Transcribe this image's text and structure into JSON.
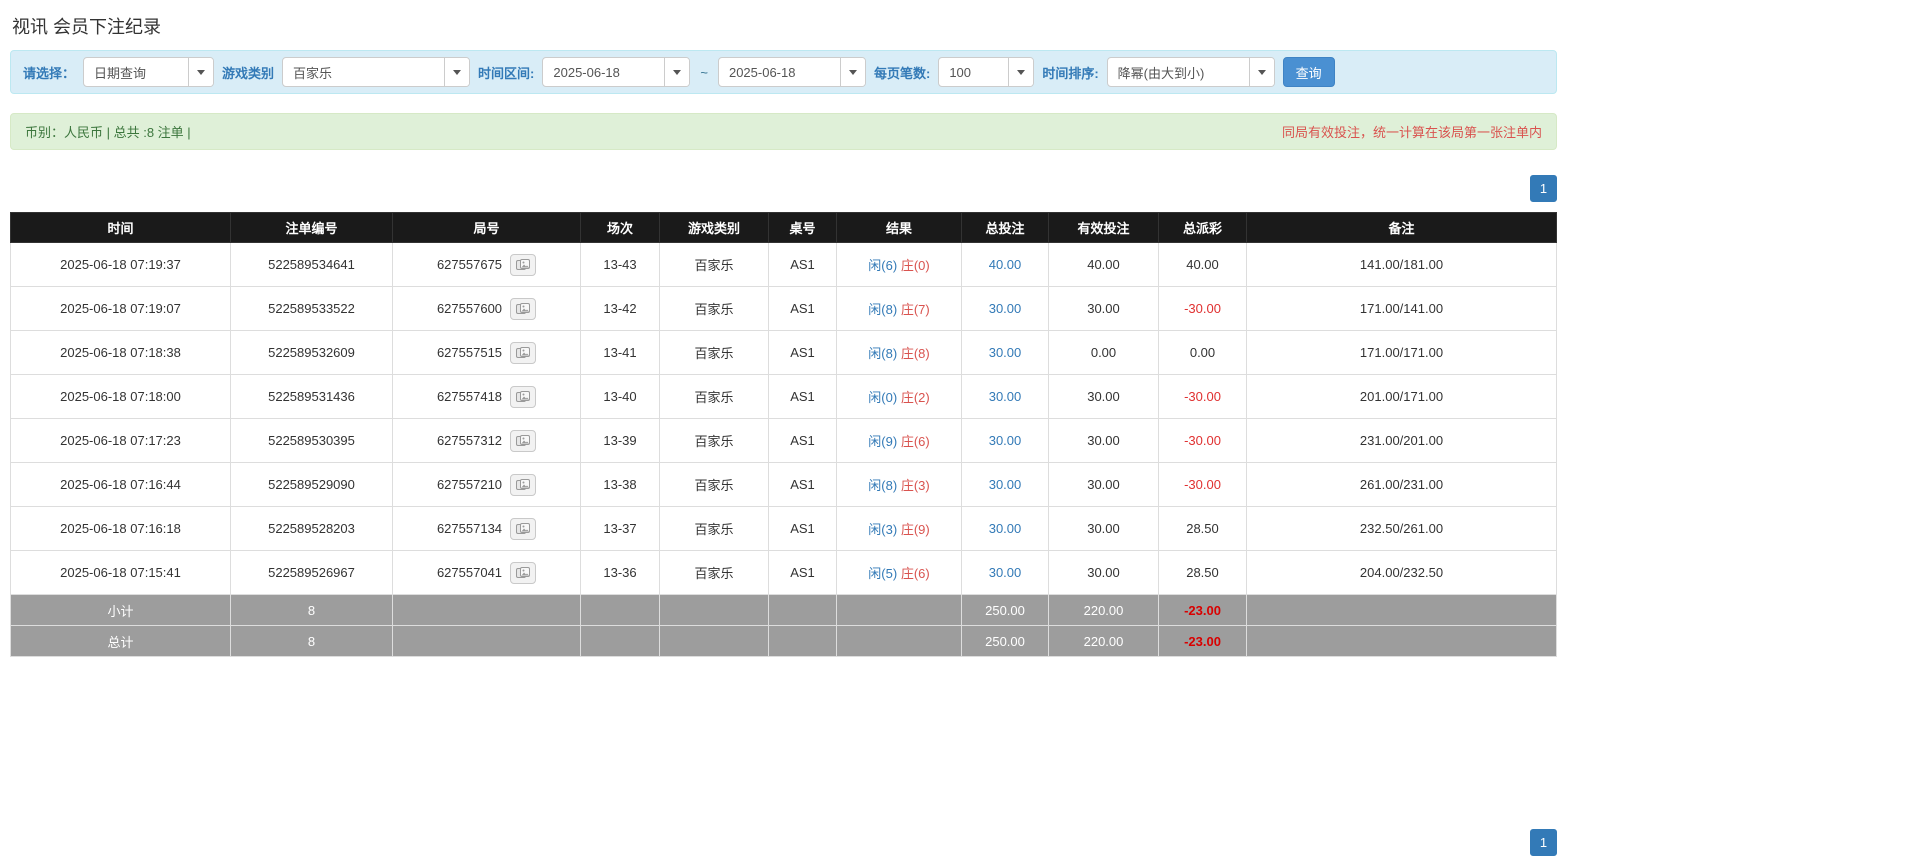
{
  "page": {
    "title": "视讯 会员下注纪录"
  },
  "filters": {
    "select_label": "请选择：",
    "select_value": "日期查询",
    "game_type_label": "游戏类别",
    "game_type_value": "百家乐",
    "time_range_label": "时间区间:",
    "date_from": "2025-06-18",
    "date_separator": "~",
    "date_to": "2025-06-18",
    "page_size_label": "每页笔数:",
    "page_size_value": "100",
    "sort_label": "时间排序:",
    "sort_value": "降幂(由大到小)",
    "search_button": "查询"
  },
  "info_bar": {
    "left": "币别：人民币 | 总共 :8 注单 |",
    "right": "同局有效投注，统一计算在该局第一张注单内"
  },
  "pagination": {
    "page": "1"
  },
  "table": {
    "headers": [
      "时间",
      "注单编号",
      "局号",
      "场次",
      "游戏类别",
      "桌号",
      "结果",
      "总投注",
      "有效投注",
      "总派彩",
      "备注"
    ],
    "rows": [
      {
        "time": "2025-06-18 07:19:37",
        "bet_id": "522589534641",
        "round_id": "627557675",
        "session": "13-43",
        "game": "百家乐",
        "table_no": "AS1",
        "result_player": "闲(6)",
        "result_banker": "庄(0)",
        "total_bet": "40.00",
        "valid_bet": "40.00",
        "payout": "40.00",
        "note": "141.00/181.00"
      },
      {
        "time": "2025-06-18 07:19:07",
        "bet_id": "522589533522",
        "round_id": "627557600",
        "session": "13-42",
        "game": "百家乐",
        "table_no": "AS1",
        "result_player": "闲(8)",
        "result_banker": "庄(7)",
        "total_bet": "30.00",
        "valid_bet": "30.00",
        "payout": "-30.00",
        "note": "171.00/141.00"
      },
      {
        "time": "2025-06-18 07:18:38",
        "bet_id": "522589532609",
        "round_id": "627557515",
        "session": "13-41",
        "game": "百家乐",
        "table_no": "AS1",
        "result_player": "闲(8)",
        "result_banker": "庄(8)",
        "total_bet": "30.00",
        "valid_bet": "0.00",
        "payout": "0.00",
        "note": "171.00/171.00"
      },
      {
        "time": "2025-06-18 07:18:00",
        "bet_id": "522589531436",
        "round_id": "627557418",
        "session": "13-40",
        "game": "百家乐",
        "table_no": "AS1",
        "result_player": "闲(0)",
        "result_banker": "庄(2)",
        "total_bet": "30.00",
        "valid_bet": "30.00",
        "payout": "-30.00",
        "note": "201.00/171.00"
      },
      {
        "time": "2025-06-18 07:17:23",
        "bet_id": "522589530395",
        "round_id": "627557312",
        "session": "13-39",
        "game": "百家乐",
        "table_no": "AS1",
        "result_player": "闲(9)",
        "result_banker": "庄(6)",
        "total_bet": "30.00",
        "valid_bet": "30.00",
        "payout": "-30.00",
        "note": "231.00/201.00"
      },
      {
        "time": "2025-06-18 07:16:44",
        "bet_id": "522589529090",
        "round_id": "627557210",
        "session": "13-38",
        "game": "百家乐",
        "table_no": "AS1",
        "result_player": "闲(8)",
        "result_banker": "庄(3)",
        "total_bet": "30.00",
        "valid_bet": "30.00",
        "payout": "-30.00",
        "note": "261.00/231.00"
      },
      {
        "time": "2025-06-18 07:16:18",
        "bet_id": "522589528203",
        "round_id": "627557134",
        "session": "13-37",
        "game": "百家乐",
        "table_no": "AS1",
        "result_player": "闲(3)",
        "result_banker": "庄(9)",
        "total_bet": "30.00",
        "valid_bet": "30.00",
        "payout": "28.50",
        "note": "232.50/261.00"
      },
      {
        "time": "2025-06-18 07:15:41",
        "bet_id": "522589526967",
        "round_id": "627557041",
        "session": "13-36",
        "game": "百家乐",
        "table_no": "AS1",
        "result_player": "闲(5)",
        "result_banker": "庄(6)",
        "total_bet": "30.00",
        "valid_bet": "30.00",
        "payout": "28.50",
        "note": "204.00/232.50"
      }
    ],
    "footer_rows": [
      {
        "label": "小计",
        "count": "8",
        "total_bet": "250.00",
        "valid_bet": "220.00",
        "payout": "-23.00"
      },
      {
        "label": "总计",
        "count": "8",
        "total_bet": "250.00",
        "valid_bet": "220.00",
        "payout": "-23.00"
      }
    ]
  }
}
